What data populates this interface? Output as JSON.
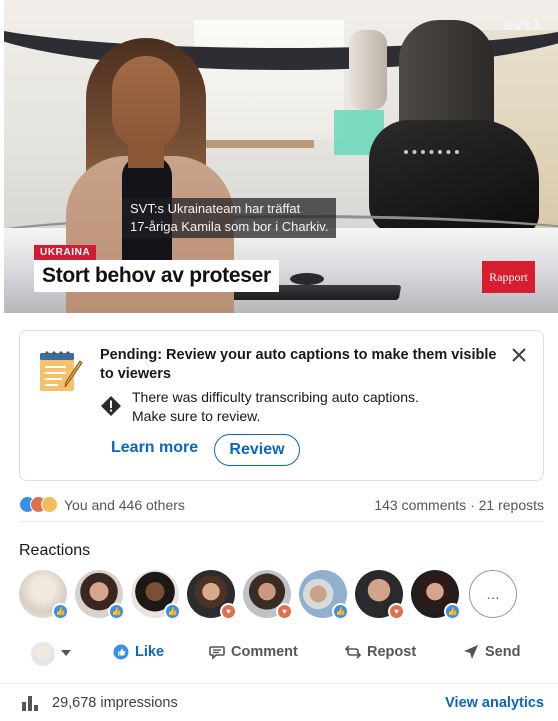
{
  "video": {
    "channel_logo": "svt1",
    "subtitle_line1": "SVT:s Ukrainateam har träffat",
    "subtitle_line2": "17-åriga Kamila som bor i Charkiv.",
    "chyron_tag": "UKRAINA",
    "chyron_headline": "Stort behov av proteser",
    "show_badge": "Rapport"
  },
  "pending_notice": {
    "icon": "notepad-icon",
    "title": "Pending: Review your auto captions to make them visible to viewers",
    "message_line1": "There was difficulty transcribing auto captions.",
    "message_line2": "Make sure to review.",
    "learn_more_label": "Learn more",
    "review_label": "Review",
    "close_icon": "close-icon"
  },
  "social_counts": {
    "reactions_text": "You and 446 others",
    "comments_text": "143 comments",
    "separator": "·",
    "reposts_text": "21 reposts"
  },
  "reactions": {
    "title": "Reactions",
    "more_label": "…",
    "people": [
      {
        "badge": "like"
      },
      {
        "badge": "like"
      },
      {
        "badge": "like"
      },
      {
        "badge": "love"
      },
      {
        "badge": "love"
      },
      {
        "badge": "like"
      },
      {
        "badge": "love"
      },
      {
        "badge": "like"
      }
    ]
  },
  "actions": {
    "like_label": "Like",
    "comment_label": "Comment",
    "repost_label": "Repost",
    "send_label": "Send"
  },
  "impressions": {
    "count_text": "29,678 impressions",
    "analytics_label": "View analytics"
  },
  "colors": {
    "accent_blue": "#0a66c2",
    "like_blue": "#378fe9",
    "love_orange": "#df704d",
    "svt_red": "#cf1b34"
  }
}
